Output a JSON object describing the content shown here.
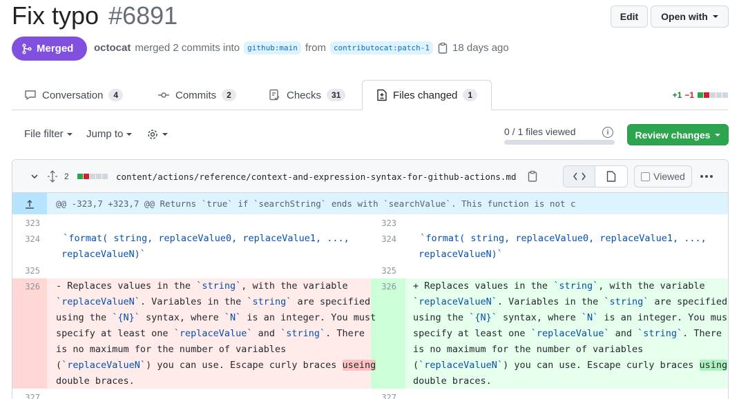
{
  "pr": {
    "title": "Fix typo",
    "number": "#6891",
    "status": "Merged",
    "author": "octocat",
    "action": "merged 2 commits into",
    "base_branch": "github:main",
    "from_word": "from",
    "head_branch": "contributocat:patch-1",
    "time": "18 days ago"
  },
  "header_buttons": {
    "edit": "Edit",
    "open_with": "Open with"
  },
  "tabs": [
    {
      "label": "Conversation",
      "count": "4",
      "icon": "comment-icon"
    },
    {
      "label": "Commits",
      "count": "2",
      "icon": "commit-icon"
    },
    {
      "label": "Checks",
      "count": "31",
      "icon": "checklist-icon"
    },
    {
      "label": "Files changed",
      "count": "1",
      "icon": "file-diff-icon"
    }
  ],
  "diffstat": {
    "additions": "+1",
    "deletions": "−1"
  },
  "toolbar": {
    "file_filter": "File filter",
    "jump_to": "Jump to",
    "files_viewed": "0 / 1 files viewed",
    "review_changes": "Review changes"
  },
  "file": {
    "changes": "2",
    "path": "content/actions/reference/context-and-expression-syntax-for-github-actions.md",
    "viewed_label": "Viewed",
    "hunk_header": "@@ -323,7 +323,7 @@ Returns `true` if `searchString` ends with `searchValue`. This function is not c"
  },
  "diff": {
    "line_numbers": {
      "l323": "323",
      "l324": "324",
      "l325": "325",
      "l326": "326",
      "l327": "327"
    },
    "ctx_324_a": "  `format( string, replaceValue0, replaceValue1, ...,",
    "ctx_324_b": "replaceValueN)`",
    "deleted_word": "useing",
    "added_word": "using"
  },
  "colors": {
    "merged": "#8250df",
    "review_button": "#2da44e",
    "addition": "#1a7f37",
    "deletion": "#cf222e",
    "deleted_line_bg": "#ffebe9",
    "added_line_bg": "#e6ffec"
  }
}
